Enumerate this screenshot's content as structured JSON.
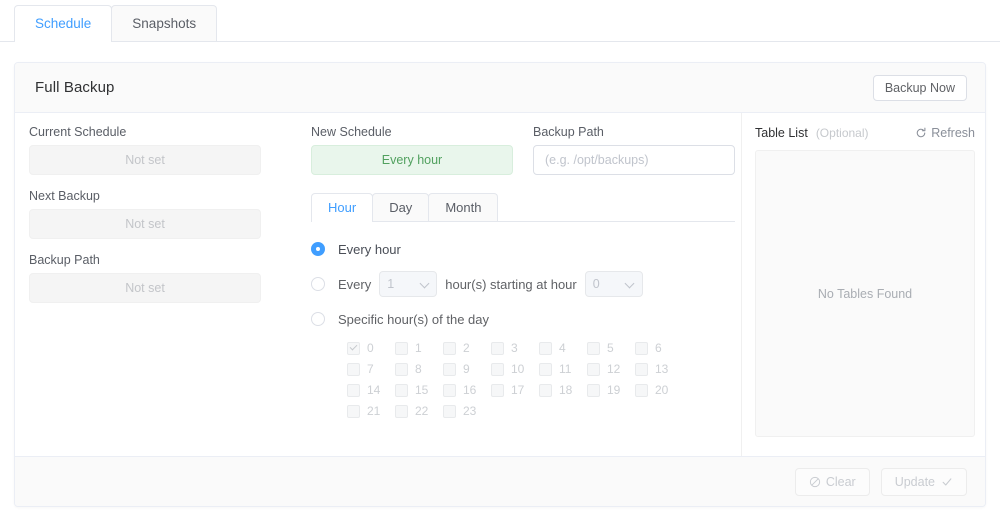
{
  "tabs": [
    {
      "label": "Schedule",
      "active": true
    },
    {
      "label": "Snapshots",
      "active": false
    }
  ],
  "card": {
    "title": "Full Backup",
    "backup_now_label": "Backup Now"
  },
  "left_column": {
    "fields": [
      {
        "label": "Current Schedule",
        "value": "Not set"
      },
      {
        "label": "Next Backup",
        "value": "Not set"
      },
      {
        "label": "Backup Path",
        "value": "Not set"
      }
    ]
  },
  "new_schedule": {
    "label": "New Schedule",
    "value": "Every hour",
    "accent_bg": "#e9f6ec",
    "accent_text": "#51a15f"
  },
  "backup_path": {
    "label": "Backup Path",
    "value": "",
    "placeholder": "(e.g. /opt/backups)"
  },
  "inner_tabs": [
    {
      "label": "Hour",
      "active": true
    },
    {
      "label": "Day",
      "active": false
    },
    {
      "label": "Month",
      "active": false
    }
  ],
  "schedule_options": {
    "every_hour": {
      "label": "Every hour",
      "selected": true
    },
    "interval": {
      "prefix": "Every",
      "interval_value": "1",
      "middle": "hour(s) starting at hour",
      "start_value": "0",
      "selected": false
    },
    "specific": {
      "label": "Specific hour(s) of the day",
      "selected": false,
      "hours": [
        {
          "value": "0",
          "checked": true
        },
        {
          "value": "1",
          "checked": false
        },
        {
          "value": "2",
          "checked": false
        },
        {
          "value": "3",
          "checked": false
        },
        {
          "value": "4",
          "checked": false
        },
        {
          "value": "5",
          "checked": false
        },
        {
          "value": "6",
          "checked": false
        },
        {
          "value": "7",
          "checked": false
        },
        {
          "value": "8",
          "checked": false
        },
        {
          "value": "9",
          "checked": false
        },
        {
          "value": "10",
          "checked": false
        },
        {
          "value": "11",
          "checked": false
        },
        {
          "value": "12",
          "checked": false
        },
        {
          "value": "13",
          "checked": false
        },
        {
          "value": "14",
          "checked": false
        },
        {
          "value": "15",
          "checked": false
        },
        {
          "value": "16",
          "checked": false
        },
        {
          "value": "17",
          "checked": false
        },
        {
          "value": "18",
          "checked": false
        },
        {
          "value": "19",
          "checked": false
        },
        {
          "value": "20",
          "checked": false
        },
        {
          "value": "21",
          "checked": false
        },
        {
          "value": "22",
          "checked": false
        },
        {
          "value": "23",
          "checked": false
        }
      ]
    }
  },
  "table_list": {
    "title": "Table List",
    "optional_label": "(Optional)",
    "refresh_label": "Refresh",
    "empty_text": "No Tables Found"
  },
  "footer": {
    "clear_label": "Clear",
    "update_label": "Update"
  },
  "colors": {
    "accent_blue": "#409eff",
    "accent_green": "#51a15f",
    "border": "#e4e7ed",
    "muted_text": "#c0c4cc"
  }
}
